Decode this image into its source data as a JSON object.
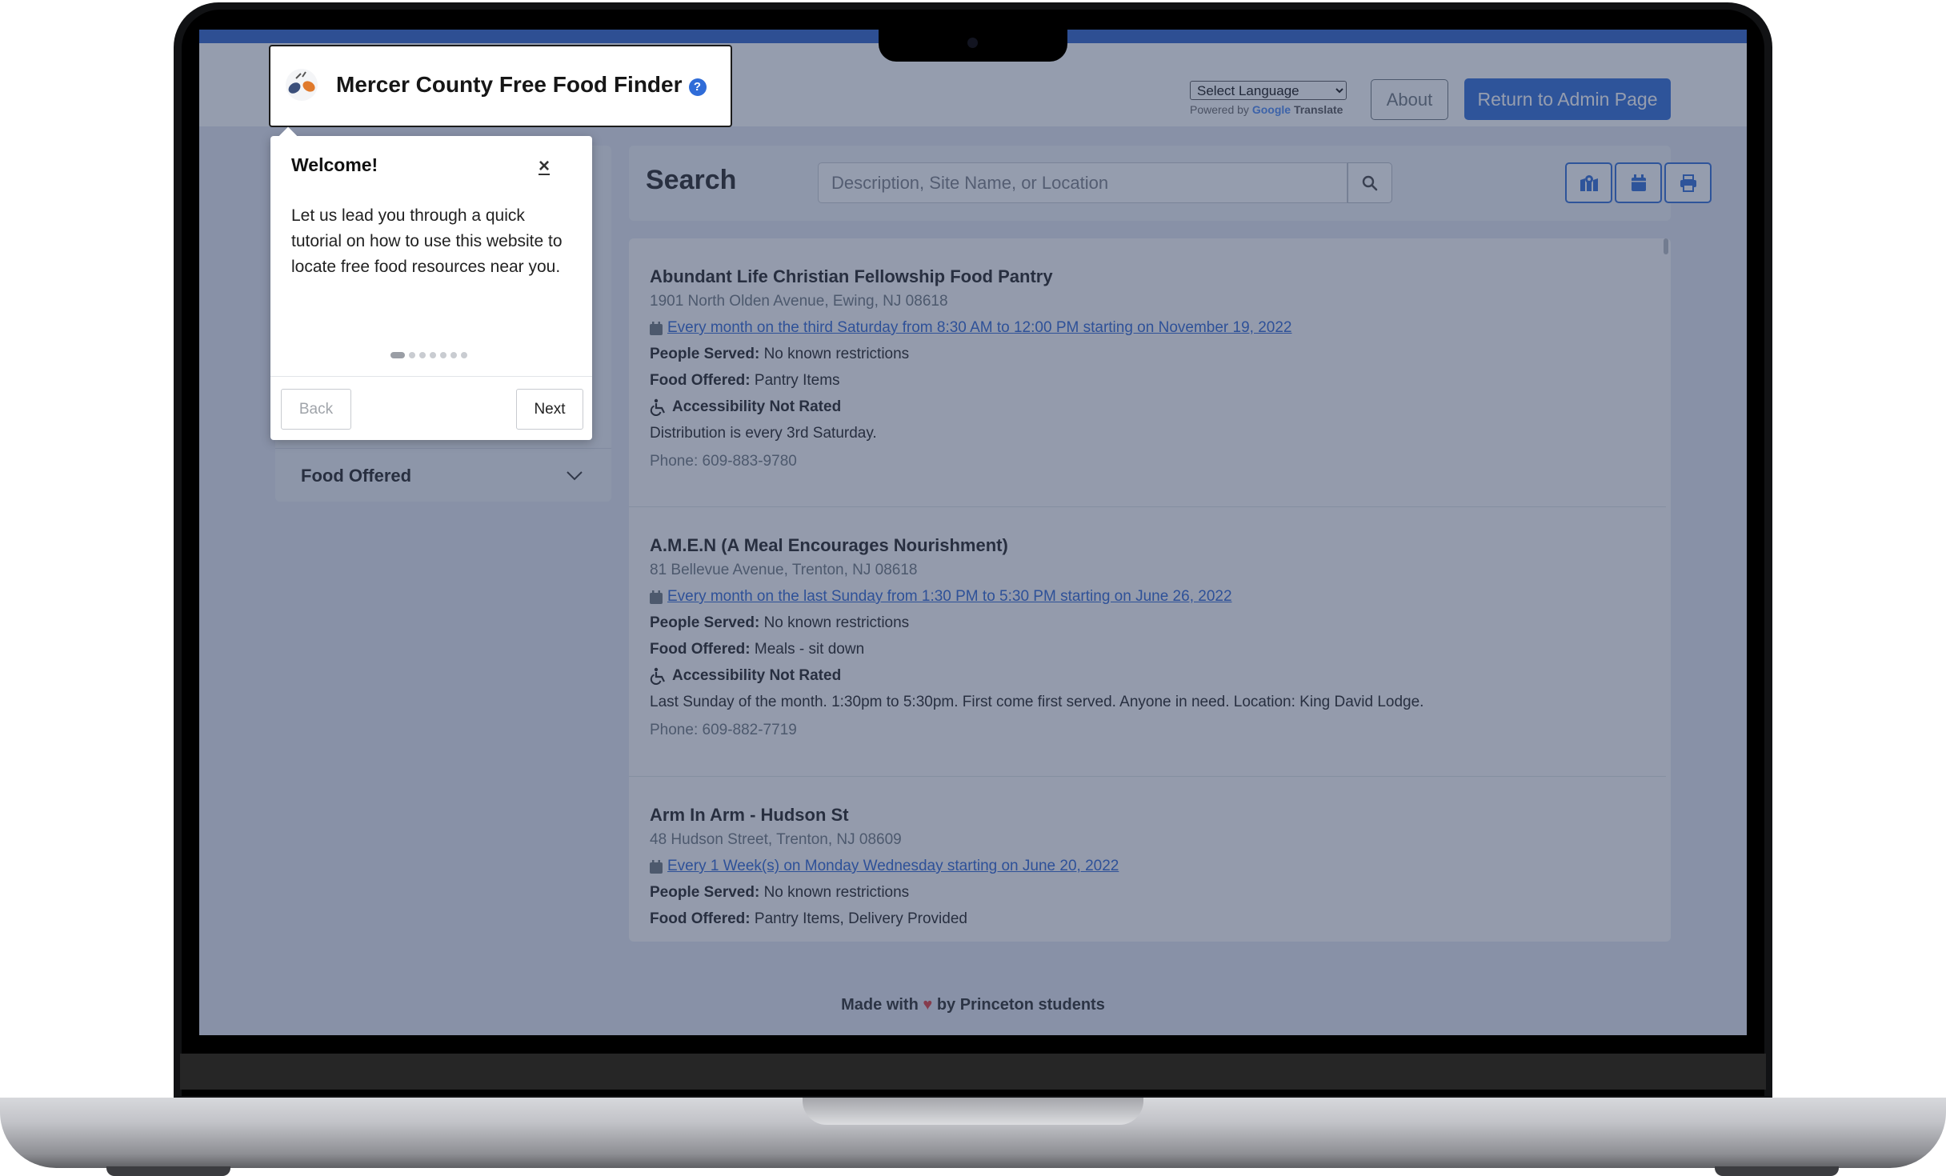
{
  "brand": {
    "title": "Mercer County Free Food Finder",
    "help_badge": "?"
  },
  "header": {
    "language_select": "Select Language",
    "powered_prefix": "Powered by",
    "google": "Google",
    "translate": "Translate",
    "about": "About",
    "admin": "Return to Admin Page"
  },
  "sidebar": {
    "food_offered": "Food Offered"
  },
  "search": {
    "title": "Search",
    "placeholder": "Description, Site Name, or Location"
  },
  "tour": {
    "title": "Welcome!",
    "close": "×",
    "body": "Let us lead you through a quick tutorial on how to use this website to locate free food resources near you.",
    "step_count": 7,
    "current_step": 1,
    "back": "Back",
    "next": "Next"
  },
  "results": [
    {
      "name": "Abundant Life Christian Fellowship Food Pantry",
      "address": "1901 North Olden Avenue, Ewing, NJ 08618",
      "schedule": "Every month on the third Saturday from 8:30 AM to 12:00 PM starting on November 19, 2022",
      "people_label": "People Served:",
      "people": "No known restrictions",
      "food_label": "Food Offered:",
      "food": "Pantry Items",
      "access": "Accessibility Not Rated",
      "description": "Distribution is every 3rd Saturday.",
      "phone": "Phone: 609-883-9780"
    },
    {
      "name": "A.M.E.N (A Meal Encourages Nourishment)",
      "address": "81 Bellevue Avenue, Trenton, NJ 08618",
      "schedule": "Every month on the last Sunday from 1:30 PM to 5:30 PM starting on June 26, 2022",
      "people_label": "People Served:",
      "people": "No known restrictions",
      "food_label": "Food Offered:",
      "food": "Meals - sit down",
      "access": "Accessibility Not Rated",
      "description": "Last Sunday of the month. 1:30pm to 5:30pm. First come first served. Anyone in need. Location: King David Lodge.",
      "phone": "Phone: 609-882-7719"
    },
    {
      "name": "Arm In Arm - Hudson St",
      "address": "48 Hudson Street, Trenton, NJ 08609",
      "schedule": "Every 1 Week(s) on Monday Wednesday starting on June 20, 2022",
      "people_label": "People Served:",
      "people": "No known restrictions",
      "food_label": "Food Offered:",
      "food": "Pantry Items, Delivery Provided"
    }
  ],
  "footer": {
    "prefix": "Made with",
    "heart": "♥",
    "suffix": "by Princeton students"
  },
  "colors": {
    "primary": "#2f6cd8",
    "link": "#2f64d1",
    "heart": "#e03b3b"
  },
  "icons": [
    "map-icon",
    "calendar-icon",
    "print-icon",
    "search-icon",
    "wheelchair-icon",
    "chevron-down-icon"
  ]
}
